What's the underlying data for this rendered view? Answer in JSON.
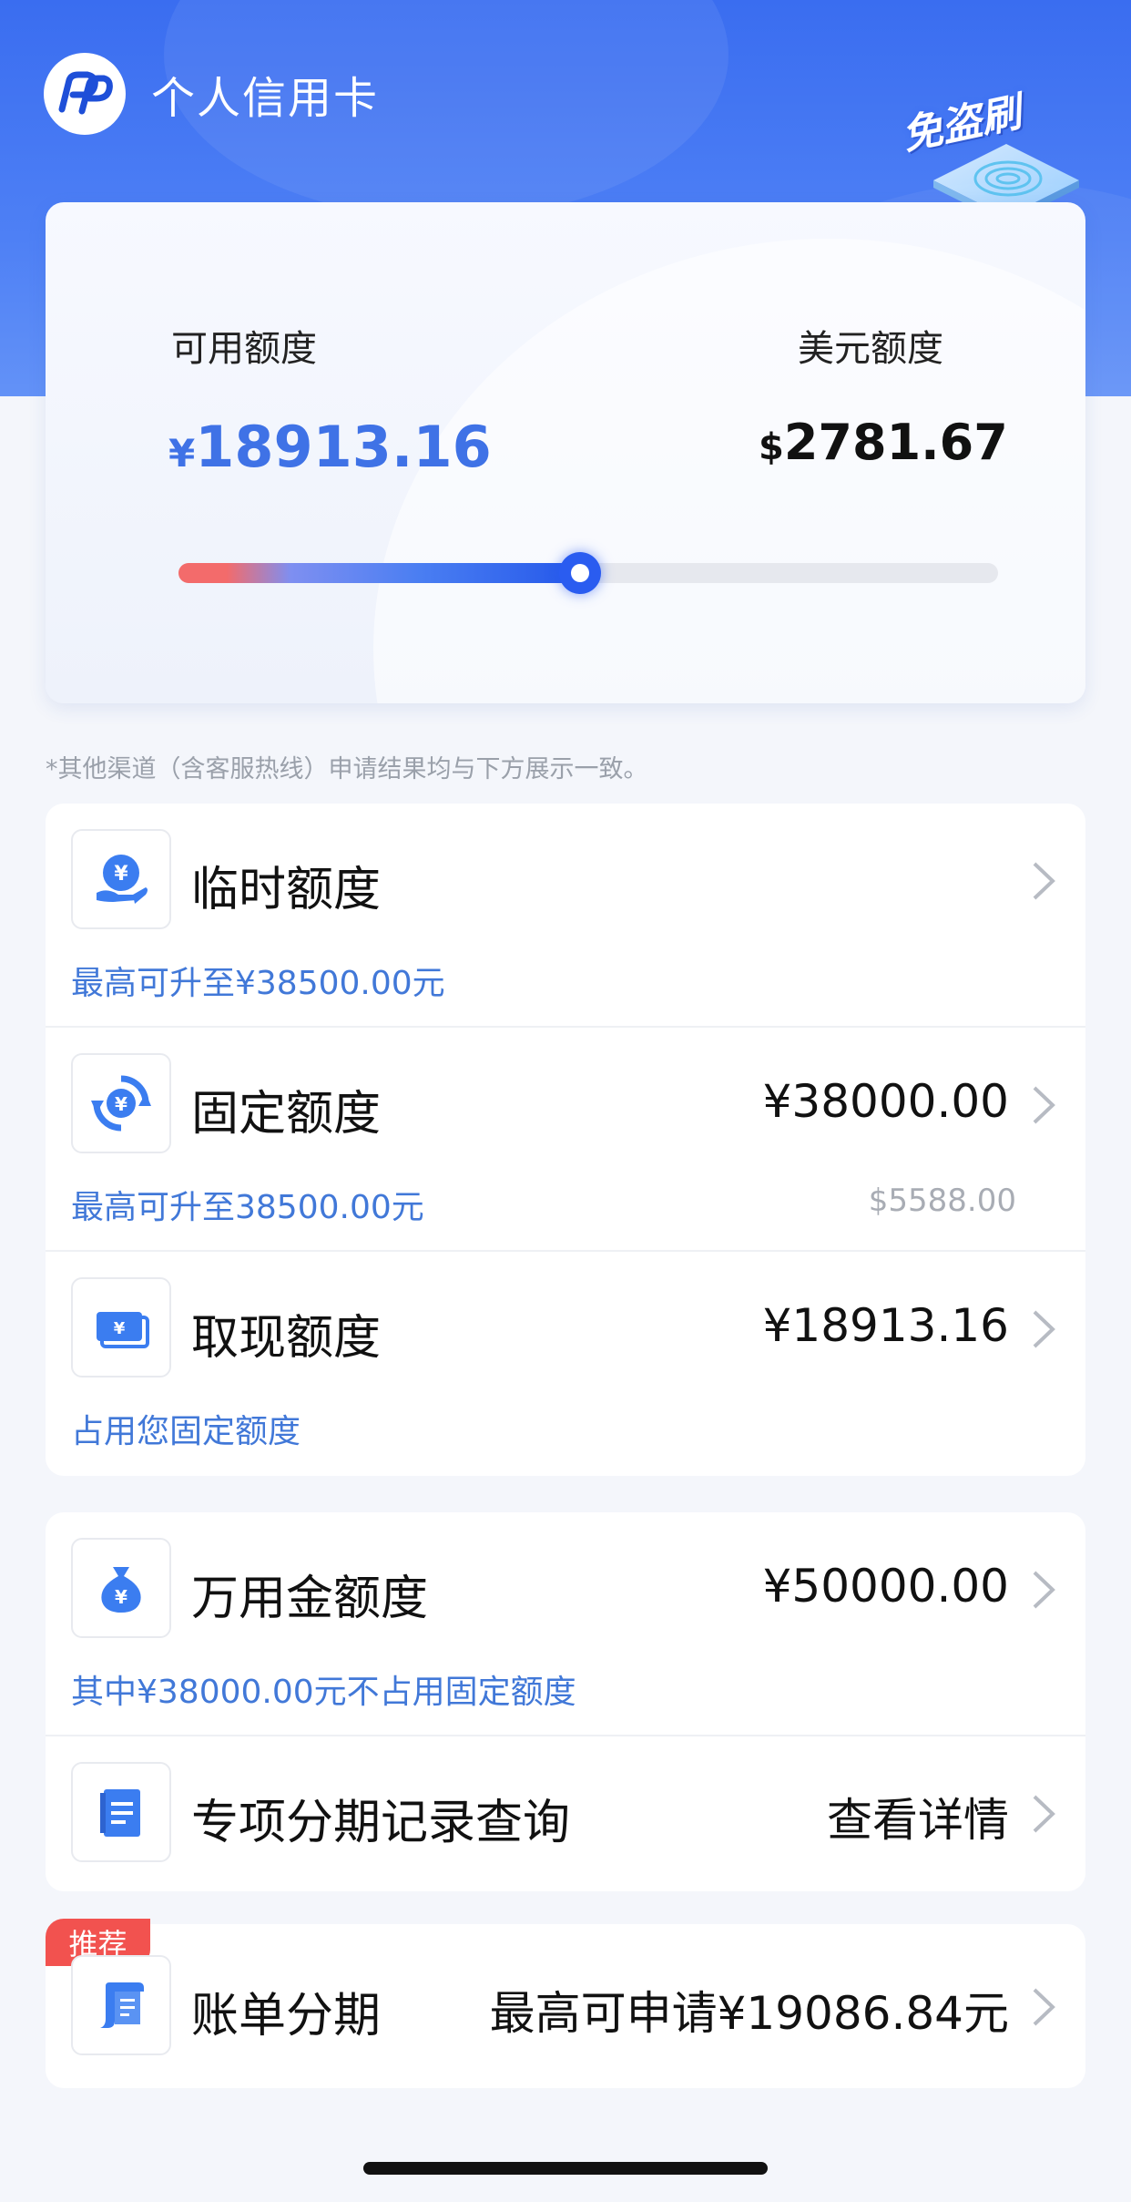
{
  "header": {
    "title": "个人信用卡",
    "badge_text": "免盗刷"
  },
  "hero": {
    "cny_label": "可用额度",
    "cny_currency": "¥",
    "cny_amount": "18913.16",
    "usd_label": "美元额度",
    "usd_currency": "$",
    "usd_amount": "2781.67",
    "slider_fraction": 0.49
  },
  "notice": "*其他渠道（含客服热线）申请结果均与下方展示一致。",
  "group1": [
    {
      "title": "临时额度",
      "value": "",
      "sub": "最高可升至¥38500.00元",
      "sub_right": "",
      "icon": "hand-yuan-icon"
    },
    {
      "title": "固定额度",
      "value": "¥38000.00",
      "sub": "最高可升至38500.00元",
      "sub_right": "$5588.00",
      "icon": "yuan-refresh-icon"
    },
    {
      "title": "取现额度",
      "value": "¥18913.16",
      "sub": "占用您固定额度",
      "sub_right": "",
      "icon": "banknote-icon"
    }
  ],
  "group2": [
    {
      "title": "万用金额度",
      "value": "¥50000.00",
      "sub": "其中¥38000.00元不占用固定额度",
      "icon": "money-bag-icon"
    },
    {
      "title": "专项分期记录查询",
      "value": "查看详情",
      "sub": "",
      "icon": "document-list-icon"
    }
  ],
  "group3": {
    "badge": "推荐",
    "title": "账单分期",
    "value": "最高可申请¥19086.84元",
    "icon": "bill-scroll-icon"
  },
  "colors": {
    "brand_blue": "#3f72e6",
    "header_blue": "#3a6df0",
    "link_blue": "#4178d8",
    "badge_red": "#f2524f"
  }
}
